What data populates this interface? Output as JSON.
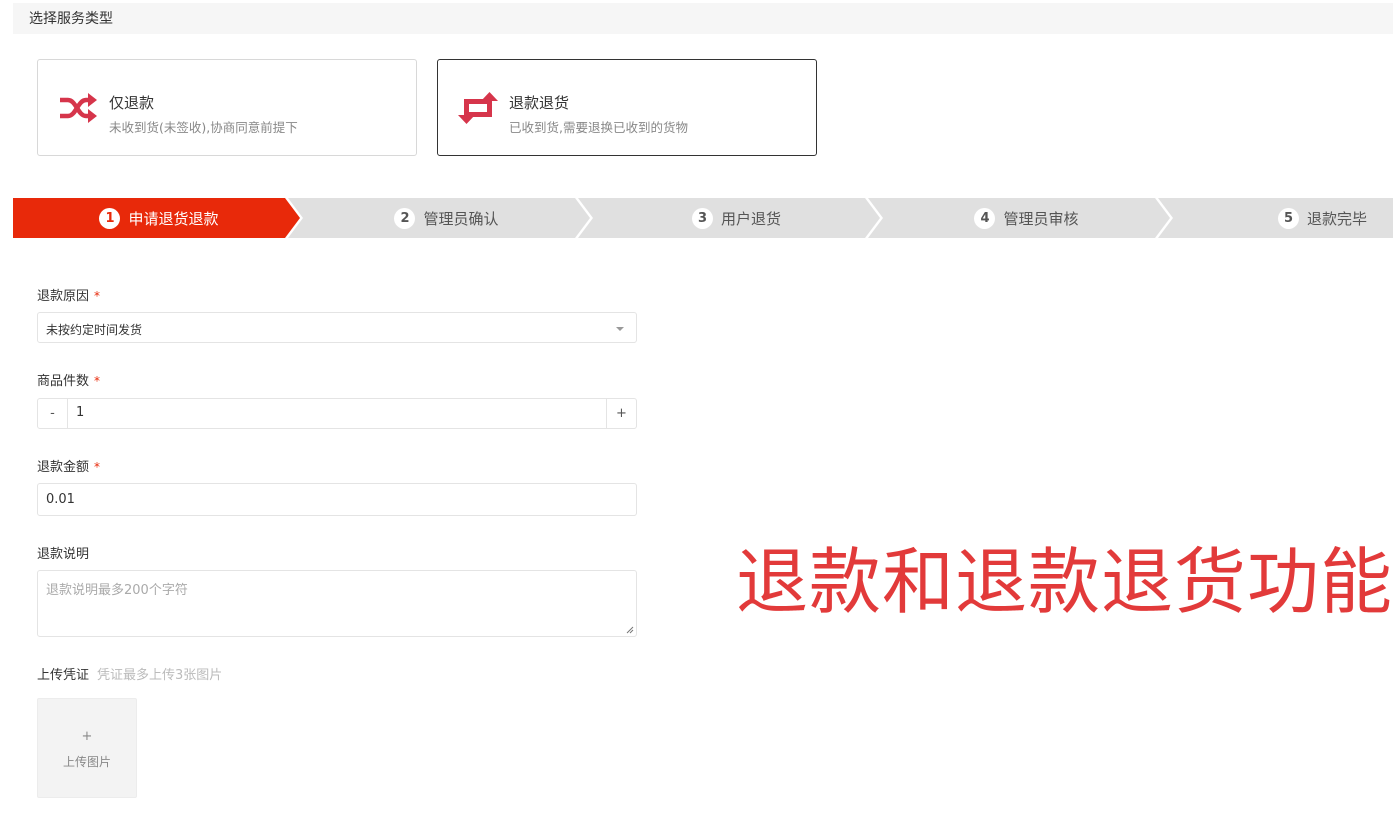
{
  "section": {
    "title": "选择服务类型"
  },
  "service_types": [
    {
      "title": "仅退款",
      "desc": "未收到货(未签收),协商同意前提下",
      "icon": "shuffle-icon",
      "selected": false
    },
    {
      "title": "退款退货",
      "desc": "已收到货,需要退换已收到的货物",
      "icon": "repeat-icon",
      "selected": true
    }
  ],
  "steps": [
    {
      "num": "1",
      "label": "申请退货退款",
      "active": true
    },
    {
      "num": "2",
      "label": "管理员确认",
      "active": false
    },
    {
      "num": "3",
      "label": "用户退货",
      "active": false
    },
    {
      "num": "4",
      "label": "管理员审核",
      "active": false
    },
    {
      "num": "5",
      "label": "退款完毕",
      "active": false
    }
  ],
  "form": {
    "reason": {
      "label": "退款原因",
      "required_mark": "*",
      "value": "未按约定时间发货"
    },
    "quantity": {
      "label": "商品件数",
      "required_mark": "*",
      "value": "1",
      "minus": "-",
      "plus": "+"
    },
    "amount": {
      "label": "退款金额",
      "required_mark": "*",
      "value": "0.01"
    },
    "note": {
      "label": "退款说明",
      "placeholder": "退款说明最多200个字符"
    },
    "upload": {
      "label": "上传凭证",
      "hint": "凭证最多上传3张图片",
      "plus": "+",
      "button_label": "上传图片"
    }
  },
  "overlay": {
    "caption": "退款和退款退货功能"
  },
  "colors": {
    "accent": "#e8290a",
    "icon": "#d6354b",
    "step_inactive": "#e0e0e0",
    "caption": "#e23a3a"
  }
}
